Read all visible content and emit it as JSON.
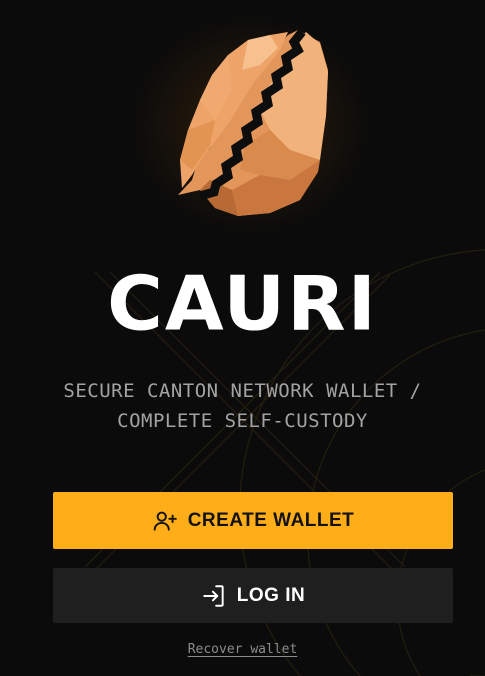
{
  "app": {
    "brand_name": "CAURI",
    "tagline_line1": "SECURE CANTON NETWORK WALLET /",
    "tagline_line2": "COMPLETE SELF-CUSTODY"
  },
  "actions": {
    "create_wallet_label": "CREATE WALLET",
    "create_wallet_icon": "user-plus-icon",
    "login_label": "LOG IN",
    "login_icon": "log-in-icon",
    "recover_label": "Recover wallet"
  },
  "theme": {
    "background": "#0b0b0b",
    "accent": "#ffae1a",
    "secondary_button": "#1f1f1f",
    "text_primary": "#ffffff",
    "text_muted": "#a3a3a3"
  }
}
